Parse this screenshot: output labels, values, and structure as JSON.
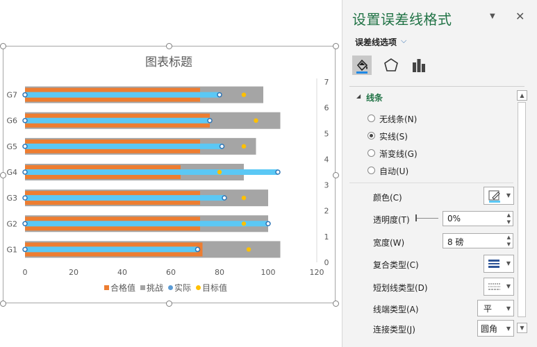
{
  "chart_data": {
    "type": "bar",
    "title": "图表标题",
    "categories": [
      "G1",
      "G2",
      "G3",
      "G4",
      "G5",
      "G6",
      "G7"
    ],
    "xlim": [
      0,
      120
    ],
    "x_ticks": [
      "0",
      "20",
      "40",
      "60",
      "80",
      "100",
      "120"
    ],
    "secondary_ylim": [
      0,
      7
    ],
    "secondary_ticks": [
      "0",
      "1",
      "2",
      "3",
      "4",
      "5",
      "6",
      "7"
    ],
    "legend_position": "bottom",
    "series": [
      {
        "name": "合格值",
        "color": "#ed7d31",
        "values": [
          73,
          72,
          72,
          64,
          72,
          76,
          72
        ]
      },
      {
        "name": "挑战",
        "color": "#a5a5a5",
        "values": [
          105,
          100,
          100,
          90,
          95,
          105,
          98
        ]
      },
      {
        "name": "实际",
        "color": "#5bc8f5",
        "values": [
          71,
          100,
          82,
          104,
          81,
          76,
          80
        ]
      },
      {
        "name": "目标值",
        "color": "#ffc000",
        "values": [
          92,
          90,
          90,
          80,
          90,
          95,
          90
        ]
      }
    ],
    "legend": [
      "合格值",
      "挑战",
      "实际",
      "目标值"
    ]
  },
  "pane": {
    "title": "设置误差线格式",
    "options_tab": "误差线选项",
    "section": "线条",
    "radios": [
      {
        "label": "无线条(N)",
        "checked": false
      },
      {
        "label": "实线(S)",
        "checked": true
      },
      {
        "label": "渐变线(G)",
        "checked": false
      },
      {
        "label": "自动(U)",
        "checked": false
      }
    ],
    "props": {
      "color_label": "颜色(C)",
      "transparency_label": "透明度(T)",
      "transparency_value": "0%",
      "width_label": "宽度(W)",
      "width_value": "8 磅",
      "compound_label": "复合类型(C)",
      "dash_label": "短划线类型(D)",
      "cap_label": "线端类型(A)",
      "cap_value": "平",
      "join_label": "连接类型(J)",
      "join_value": "圆角"
    }
  }
}
